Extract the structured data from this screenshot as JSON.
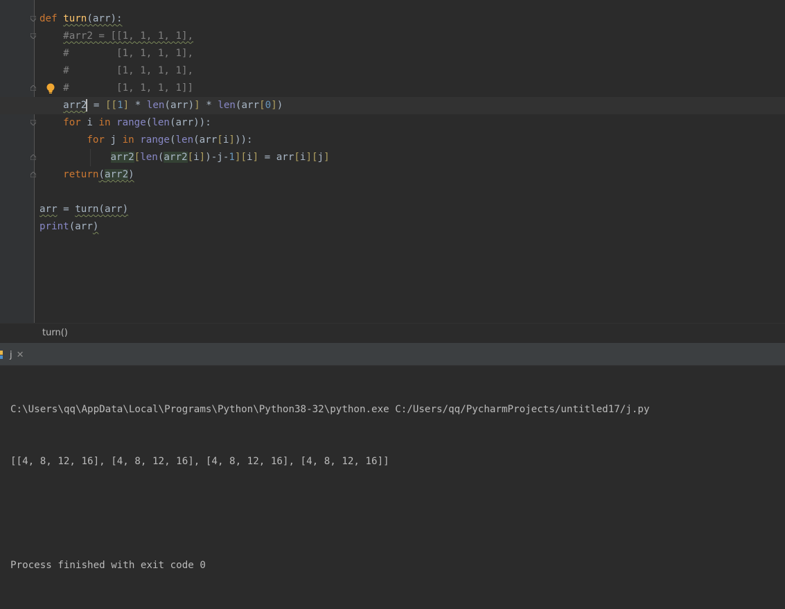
{
  "editor": {
    "lines": [
      "def turn(arr):",
      "    #arr2 = [[1, 1, 1, 1],",
      "    #        [1, 1, 1, 1],",
      "    #        [1, 1, 1, 1],",
      "    #        [1, 1, 1, 1]]",
      "    arr2 = [[1] * len(arr)] * len(arr[0])",
      "    for i in range(len(arr)):",
      "        for j in range(len(arr[i])):",
      "            arr2[len(arr2[i])-j-1][i] = arr[i][j]",
      "    return(arr2)",
      "",
      "arr = turn(arr)",
      "print(arr)"
    ],
    "colors": {
      "background": "#2b2b2b",
      "keyword": "#cc7832",
      "function": "#ffc66d",
      "builtin": "#8888c6",
      "number": "#6897bb",
      "comment": "#808080",
      "text": "#a9b7c6"
    }
  },
  "breadcrumb": {
    "text": "turn()"
  },
  "run_panel": {
    "tab_label": "j",
    "close_icon": "close-icon",
    "output": [
      "C:\\Users\\qq\\AppData\\Local\\Programs\\Python\\Python38-32\\python.exe C:/Users/qq/PycharmProjects/untitled17/j.py",
      "[[4, 8, 12, 16], [4, 8, 12, 16], [4, 8, 12, 16], [4, 8, 12, 16]]",
      "",
      "Process finished with exit code 0"
    ]
  }
}
